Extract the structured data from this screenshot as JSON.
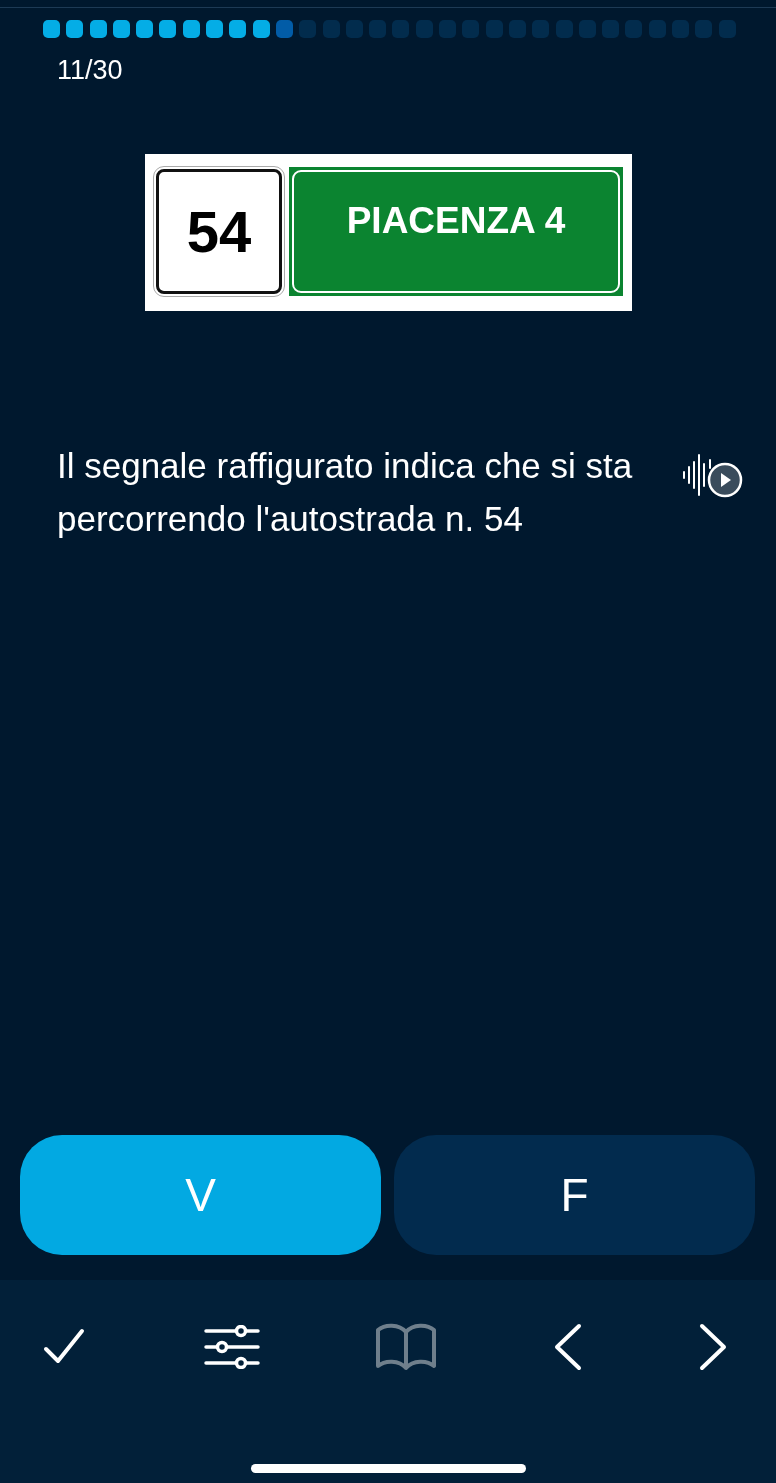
{
  "progress": {
    "steps": [
      {
        "kind": "done"
      },
      {
        "kind": "done"
      },
      {
        "kind": "done"
      },
      {
        "kind": "done"
      },
      {
        "kind": "done"
      },
      {
        "kind": "done"
      },
      {
        "kind": "done"
      },
      {
        "kind": "done"
      },
      {
        "kind": "done"
      },
      {
        "kind": "done"
      },
      {
        "kind": "current"
      },
      {
        "kind": "todo"
      },
      {
        "kind": "todo"
      },
      {
        "kind": "todo"
      },
      {
        "kind": "todo"
      },
      {
        "kind": "todo"
      },
      {
        "kind": "todo"
      },
      {
        "kind": "todo"
      },
      {
        "kind": "todo"
      },
      {
        "kind": "todo"
      },
      {
        "kind": "todo"
      },
      {
        "kind": "todo"
      },
      {
        "kind": "todo"
      },
      {
        "kind": "todo"
      },
      {
        "kind": "todo"
      },
      {
        "kind": "todo"
      },
      {
        "kind": "todo"
      },
      {
        "kind": "todo"
      },
      {
        "kind": "todo"
      },
      {
        "kind": "todo"
      }
    ],
    "counter": "11/30"
  },
  "sign": {
    "number": "54",
    "destination": "PIACENZA 4"
  },
  "question": {
    "text": "Il segnale raffigurato indica che si sta percorrendo l'autostrada n. 54"
  },
  "answers": [
    {
      "label": "V",
      "selected": true
    },
    {
      "label": "F",
      "selected": false
    }
  ],
  "toolbar": [
    {
      "kind": "check",
      "disabled": false
    },
    {
      "kind": "sliders",
      "disabled": false
    },
    {
      "kind": "book",
      "disabled": true
    },
    {
      "kind": "prev",
      "disabled": false
    },
    {
      "kind": "next",
      "disabled": false
    }
  ]
}
